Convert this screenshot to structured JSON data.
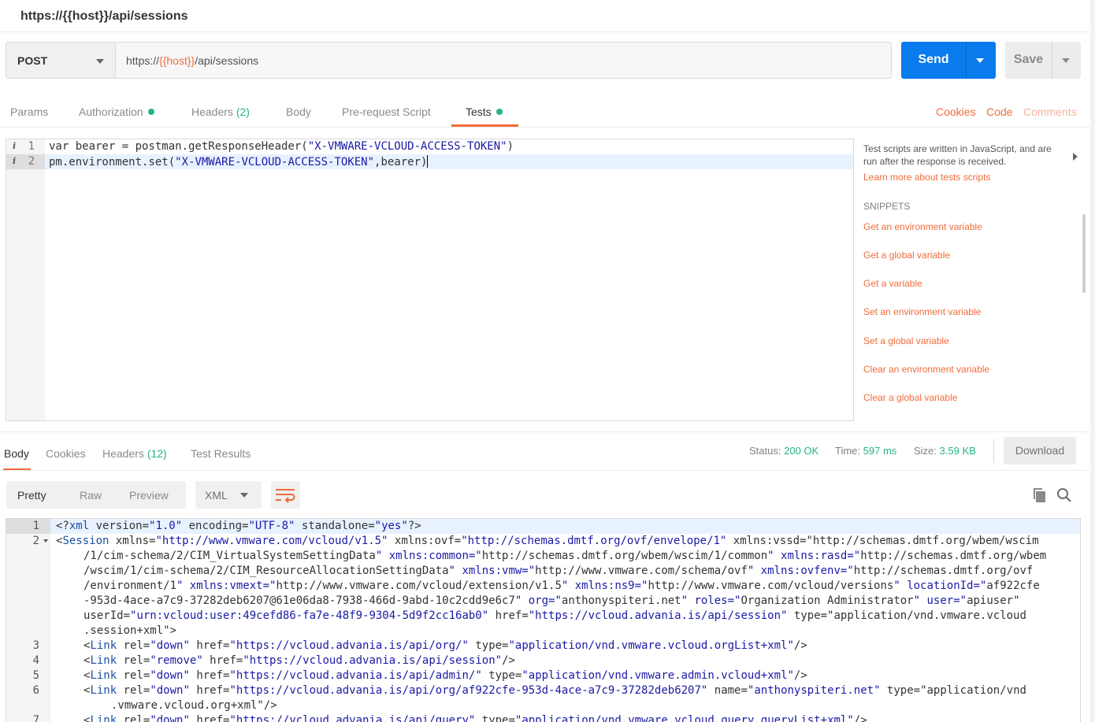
{
  "header": {
    "title": "https://{{host}}/api/sessions"
  },
  "request": {
    "method": "POST",
    "url_prefix": "https://",
    "url_var": "{{host}}",
    "url_suffix": "/api/sessions",
    "send_label": "Send",
    "save_label": "Save"
  },
  "req_tabs": {
    "params": "Params",
    "authorization": "Authorization",
    "headers": "Headers",
    "headers_count": "(2)",
    "body": "Body",
    "prerequest": "Pre-request Script",
    "tests": "Tests",
    "cookies": "Cookies",
    "code": "Code",
    "comments": "Comments"
  },
  "editor": {
    "lines": [
      {
        "num": "1",
        "parts": [
          "var bearer = postman.getResponseHeader(",
          "\"X-VMWARE-VCLOUD-ACCESS-TOKEN\"",
          ")"
        ]
      },
      {
        "num": "2",
        "parts": [
          "pm.environment.set(",
          "\"X-VMWARE-VCLOUD-ACCESS-TOKEN\"",
          ",bearer)"
        ]
      }
    ],
    "info_icon": "i"
  },
  "sidebar": {
    "description": "Test scripts are written in JavaScript, and are run after the response is received.",
    "learn_link": "Learn more about tests scripts",
    "snippets_heading": "SNIPPETS",
    "snippets": [
      "Get an environment variable",
      "Get a global variable",
      "Get a variable",
      "Set an environment variable",
      "Set a global variable",
      "Clear an environment variable",
      "Clear a global variable"
    ]
  },
  "response": {
    "tabs": {
      "body": "Body",
      "cookies": "Cookies",
      "headers": "Headers",
      "headers_count": "(12)",
      "test_results": "Test Results"
    },
    "status_label": "Status:",
    "status_value": "200 OK",
    "time_label": "Time:",
    "time_value": "597 ms",
    "size_label": "Size:",
    "size_value": "3.59 KB",
    "download_label": "Download",
    "format": {
      "pretty": "Pretty",
      "raw": "Raw",
      "preview": "Preview",
      "lang": "XML"
    },
    "lines": [
      {
        "num": "1",
        "indent": 0,
        "text": "<?xml version=\"1.0\" encoding=\"UTF-8\" standalone=\"yes\"?>"
      },
      {
        "num": "2",
        "indent": 0,
        "fold": true,
        "text": "<Session xmlns=\"http://www.vmware.com/vcloud/v1.5\" xmlns:ovf=\"http://schemas.dmtf.org/ovf/envelope/1\" xmlns:vssd=\"http://schemas.dmtf.org/wbem/wscim"
      },
      {
        "num": "",
        "indent": 1,
        "text": "/1/cim-schema/2/CIM_VirtualSystemSettingData\" xmlns:common=\"http://schemas.dmtf.org/wbem/wscim/1/common\" xmlns:rasd=\"http://schemas.dmtf.org/wbem"
      },
      {
        "num": "",
        "indent": 1,
        "text": "/wscim/1/cim-schema/2/CIM_ResourceAllocationSettingData\" xmlns:vmw=\"http://www.vmware.com/schema/ovf\" xmlns:ovfenv=\"http://schemas.dmtf.org/ovf"
      },
      {
        "num": "",
        "indent": 1,
        "text": "/environment/1\" xmlns:vmext=\"http://www.vmware.com/vcloud/extension/v1.5\" xmlns:ns9=\"http://www.vmware.com/vcloud/versions\" locationId=\"af922cfe"
      },
      {
        "num": "",
        "indent": 1,
        "text": "-953d-4ace-a7c9-37282deb6207@61e06da8-7938-466d-9abd-10c2cdd9e6c7\" org=\"anthonyspiteri.net\" roles=\"Organization Administrator\" user=\"apiuser\""
      },
      {
        "num": "",
        "indent": 1,
        "text": "userId=\"urn:vcloud:user:49cefd86-fa7e-48f9-9304-5d9f2cc16ab0\" href=\"https://vcloud.advania.is/api/session\" type=\"application/vnd.vmware.vcloud"
      },
      {
        "num": "",
        "indent": 1,
        "text": ".session+xml\">"
      },
      {
        "num": "3",
        "indent": 1,
        "text": "<Link rel=\"down\" href=\"https://vcloud.advania.is/api/org/\" type=\"application/vnd.vmware.vcloud.orgList+xml\"/>"
      },
      {
        "num": "4",
        "indent": 1,
        "text": "<Link rel=\"remove\" href=\"https://vcloud.advania.is/api/session\"/>"
      },
      {
        "num": "5",
        "indent": 1,
        "text": "<Link rel=\"down\" href=\"https://vcloud.advania.is/api/admin/\" type=\"application/vnd.vmware.admin.vcloud+xml\"/>"
      },
      {
        "num": "6",
        "indent": 1,
        "text": "<Link rel=\"down\" href=\"https://vcloud.advania.is/api/org/af922cfe-953d-4ace-a7c9-37282deb6207\" name=\"anthonyspiteri.net\" type=\"application/vnd"
      },
      {
        "num": "",
        "indent": 2,
        "text": ".vmware.vcloud.org+xml\"/>"
      },
      {
        "num": "7",
        "indent": 1,
        "text": "<Link rel=\"down\" href=\"https://vcloud.advania.is/api/query\" type=\"application/vnd.vmware.vcloud.query.queryList+xml\"/>"
      }
    ]
  },
  "colors": {
    "accent": "#f26b3a",
    "send": "#097bed",
    "success": "#26b47f"
  }
}
